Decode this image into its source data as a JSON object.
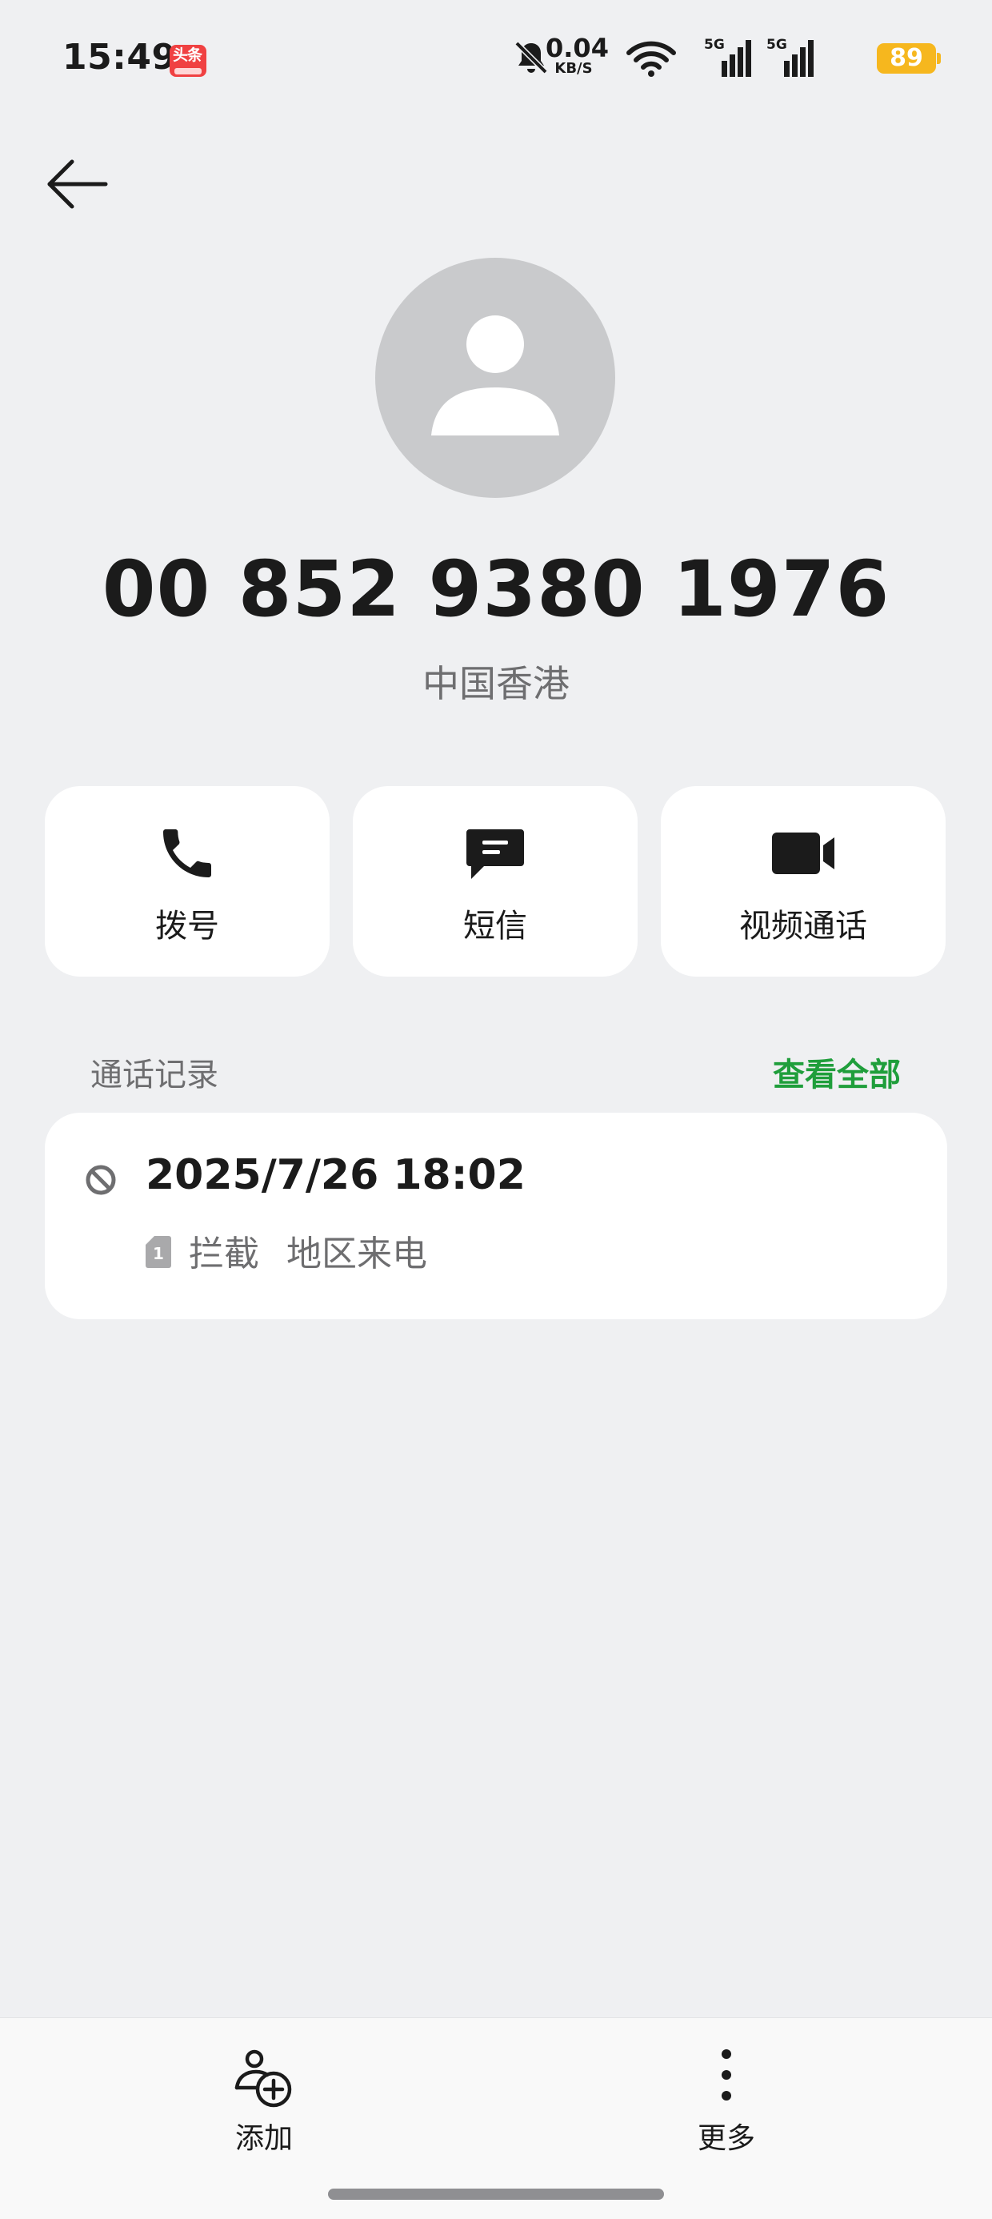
{
  "status_bar": {
    "time": "15:49",
    "app_badge": "头条",
    "net_speed_value": "0.04",
    "net_speed_unit": "KB/S",
    "signal_1_label": "5G",
    "signal_2_label": "5G",
    "battery": "89",
    "battery_color": "#f6b71e"
  },
  "header": {
    "back_icon": "arrow-left-icon"
  },
  "contact": {
    "avatar_icon": "person-icon",
    "number": "00 852 9380 1976",
    "region": "中国香港"
  },
  "actions": [
    {
      "label": "拨号",
      "icon": "phone-icon"
    },
    {
      "label": "短信",
      "icon": "message-icon"
    },
    {
      "label": "视频通话",
      "icon": "video-camera-icon"
    }
  ],
  "call_log": {
    "title": "通话记录",
    "view_all": "查看全部",
    "accent_color": "#1f9e3b",
    "entries": [
      {
        "datetime": "2025/7/26 18:02",
        "status": "拦截",
        "type": "地区来电",
        "status_icon": "blocked-icon",
        "sim_icon": "sim-1-icon"
      }
    ]
  },
  "bottom_bar": {
    "add_label": "添加",
    "more_label": "更多"
  }
}
